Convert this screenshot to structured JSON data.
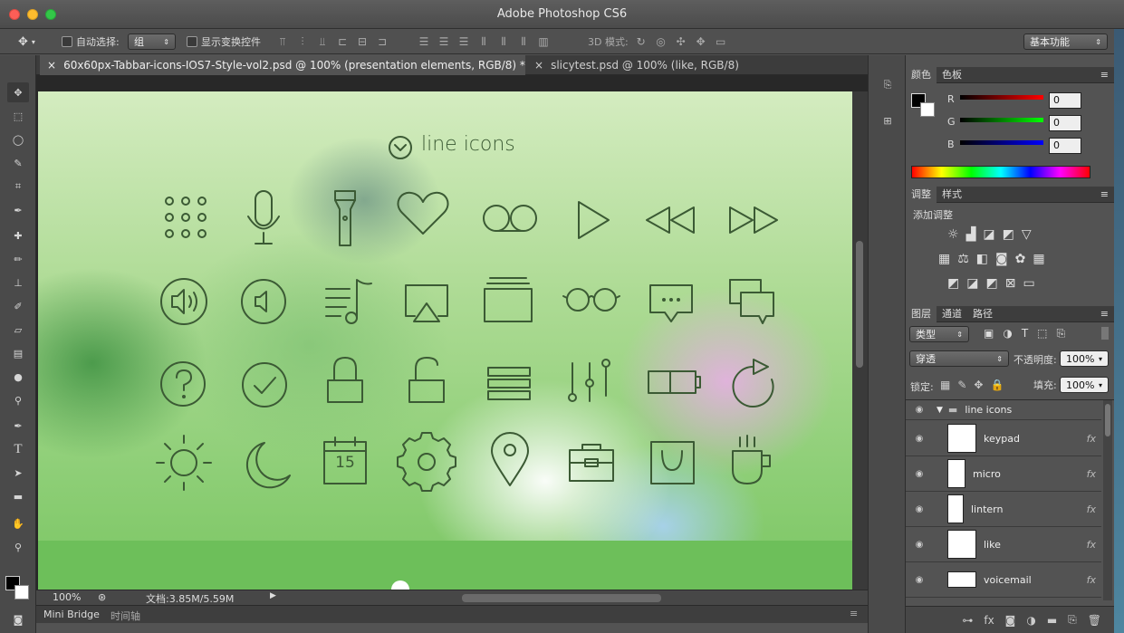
{
  "app": {
    "title": "Adobe Photoshop CS6"
  },
  "options": {
    "auto_select_label": "自动选择:",
    "auto_select_value": "组",
    "show_transform_label": "显示变换控件",
    "mode3d_label": "3D 模式:",
    "workspace": "基本功能"
  },
  "tabs": [
    {
      "label": "60x60px-Tabbar-icons-IOS7-Style-vol2.psd @ 100% (presentation elements, RGB/8) *",
      "close": "×"
    },
    {
      "label": "slicytest.psd @ 100% (like, RGB/8)",
      "close": "×"
    }
  ],
  "canvas": {
    "section_title": "line icons"
  },
  "status": {
    "zoom": "100%",
    "doc_info": "文档:3.85M/5.59M"
  },
  "bottom_tabs": [
    "Mini Bridge",
    "时间轴"
  ],
  "panels": {
    "color": {
      "tabs": [
        "颜色",
        "色板"
      ],
      "r_label": "R",
      "g_label": "G",
      "b_label": "B",
      "r": "0",
      "g": "0",
      "b": "0"
    },
    "adjust": {
      "tabs": [
        "调整",
        "样式"
      ],
      "add_label": "添加调整"
    },
    "layers": {
      "tabs": [
        "图层",
        "通道",
        "路径"
      ],
      "filter": "类型",
      "blend": "穿透",
      "opacity_label": "不透明度:",
      "opacity": "100%",
      "lock_label": "锁定:",
      "fill_label": "填充:",
      "fill": "100%",
      "group": "line icons",
      "items": [
        {
          "name": "keypad",
          "fx": "fx"
        },
        {
          "name": "micro",
          "fx": "fx"
        },
        {
          "name": "lintern",
          "fx": "fx"
        },
        {
          "name": "like",
          "fx": "fx"
        },
        {
          "name": "voicemail",
          "fx": "fx"
        }
      ]
    }
  },
  "icons": [
    "keypad-icon",
    "microphone-icon",
    "flashlight-icon",
    "heart-icon",
    "voicemail-icon",
    "play-icon",
    "rewind-icon",
    "fast-forward-icon",
    "speaker-loud-icon",
    "speaker-icon",
    "music-list-icon",
    "airplay-icon",
    "stack-icon",
    "glasses-icon",
    "chat-bubble-icon",
    "chats-icon",
    "question-icon",
    "check-icon",
    "lock-icon",
    "unlock-icon",
    "list-icon",
    "sliders-icon",
    "battery-icon",
    "refresh-icon",
    "sun-icon",
    "moon-icon",
    "calendar-icon",
    "gear-icon",
    "location-pin-icon",
    "briefcase-icon",
    "shopping-bag-icon",
    "coffee-icon"
  ],
  "calendar_day": "15",
  "colors": {
    "icon_stroke": "#3b5a34",
    "accent_bar": "#6dbf5a"
  }
}
